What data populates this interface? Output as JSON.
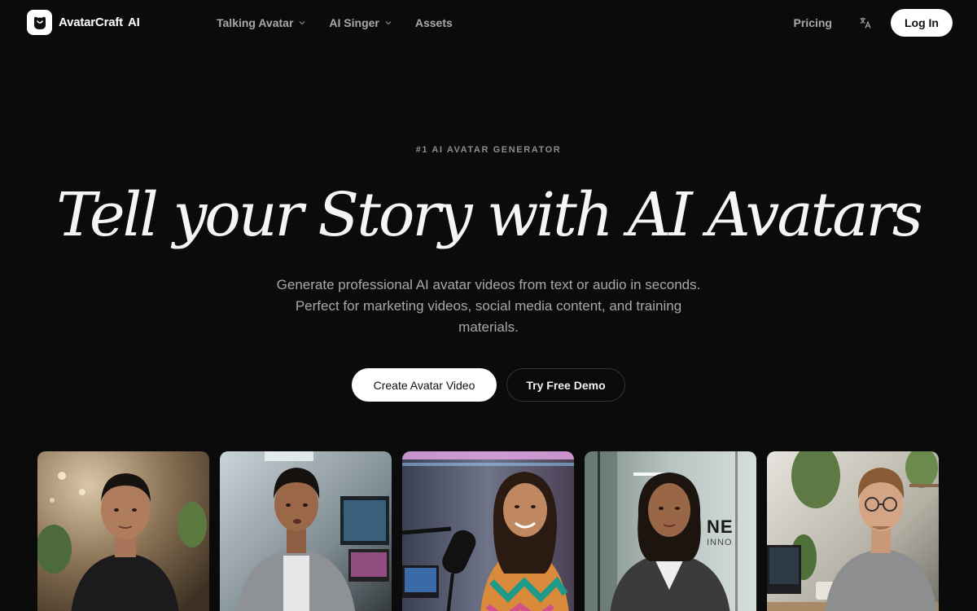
{
  "nav": {
    "brand": "AvatarCraft",
    "brand_suffix": "AI",
    "links": [
      {
        "label": "Talking Avatar",
        "has_dropdown": true
      },
      {
        "label": "AI Singer",
        "has_dropdown": true
      },
      {
        "label": "Assets",
        "has_dropdown": false
      }
    ],
    "pricing": "Pricing",
    "login": "Log In",
    "language_icon": "translate-icon"
  },
  "hero": {
    "eyebrow": "#1 AI AVATAR GENERATOR",
    "headline": "Tell your Story with AI Avatars",
    "subtitle": "Generate professional AI avatar videos from text or audio in seconds. Perfect for marketing videos, social media content, and training materials.",
    "cta_primary": "Create Avatar Video",
    "cta_secondary": "Try Free Demo"
  },
  "avatars": [
    {
      "name": "avatar-card-1"
    },
    {
      "name": "avatar-card-2"
    },
    {
      "name": "avatar-card-3"
    },
    {
      "name": "avatar-card-4",
      "overlay": "NE",
      "overlay_sub": "INNO"
    },
    {
      "name": "avatar-card-5"
    }
  ],
  "colors": {
    "background": "#0b0b0b",
    "text_primary": "#f5f5f5",
    "text_muted": "#a8a8a8",
    "button_light": "#ffffff"
  }
}
